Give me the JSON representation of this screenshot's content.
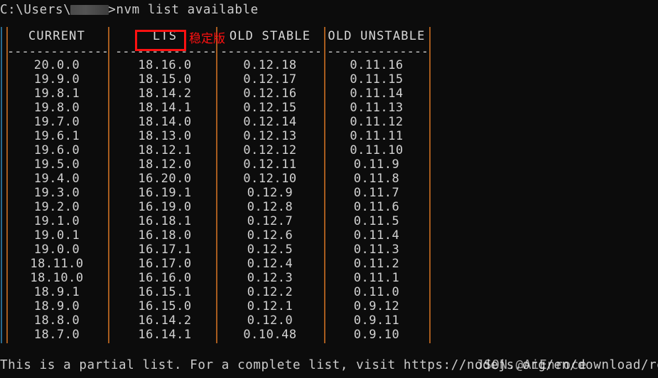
{
  "terminal": {
    "background_color": "#0c0c0c",
    "text_color": "#cccccc",
    "prompt_prefix": "C:\\Users\\",
    "prompt_suffix": ">",
    "command": "nvm list available",
    "redacted_username": ""
  },
  "annotation": {
    "note_text": "稳定版",
    "note_color": "#ff1111",
    "highlight_target": "LTS",
    "highlight_color": "#ff1111"
  },
  "table": {
    "separator_color": "#a85c1e",
    "edge_color": "#2a6b8f",
    "dashes": "--------------",
    "columns": [
      {
        "header": "CURRENT",
        "values": [
          "20.0.0",
          "19.9.0",
          "19.8.1",
          "19.8.0",
          "19.7.0",
          "19.6.1",
          "19.6.0",
          "19.5.0",
          "19.4.0",
          "19.3.0",
          "19.2.0",
          "19.1.0",
          "19.0.1",
          "19.0.0",
          "18.11.0",
          "18.10.0",
          "18.9.1",
          "18.9.0",
          "18.8.0",
          "18.7.0"
        ]
      },
      {
        "header": "LTS",
        "values": [
          "18.16.0",
          "18.15.0",
          "18.14.2",
          "18.14.1",
          "18.14.0",
          "18.13.0",
          "18.12.1",
          "18.12.0",
          "16.20.0",
          "16.19.1",
          "16.19.0",
          "16.18.1",
          "16.18.0",
          "16.17.1",
          "16.17.0",
          "16.16.0",
          "16.15.1",
          "16.15.0",
          "16.14.2",
          "16.14.1"
        ]
      },
      {
        "header": "OLD STABLE",
        "values": [
          "0.12.18",
          "0.12.17",
          "0.12.16",
          "0.12.15",
          "0.12.14",
          "0.12.13",
          "0.12.12",
          "0.12.11",
          "0.12.10",
          "0.12.9",
          "0.12.8",
          "0.12.7",
          "0.12.6",
          "0.12.5",
          "0.12.4",
          "0.12.3",
          "0.12.2",
          "0.12.1",
          "0.12.0",
          "0.10.48"
        ]
      },
      {
        "header": "OLD UNSTABLE",
        "values": [
          "0.11.16",
          "0.11.15",
          "0.11.14",
          "0.11.13",
          "0.11.12",
          "0.11.11",
          "0.11.10",
          "0.11.9",
          "0.11.8",
          "0.11.7",
          "0.11.6",
          "0.11.5",
          "0.11.4",
          "0.11.3",
          "0.11.2",
          "0.11.1",
          "0.11.0",
          "0.9.12",
          "0.9.11",
          "0.9.10"
        ]
      }
    ]
  },
  "footer": {
    "message": "This is a partial list. For a complete list, visit https://nodejs.org/en/download/releases",
    "overlay_text": "JSON.@AiEnroce"
  }
}
